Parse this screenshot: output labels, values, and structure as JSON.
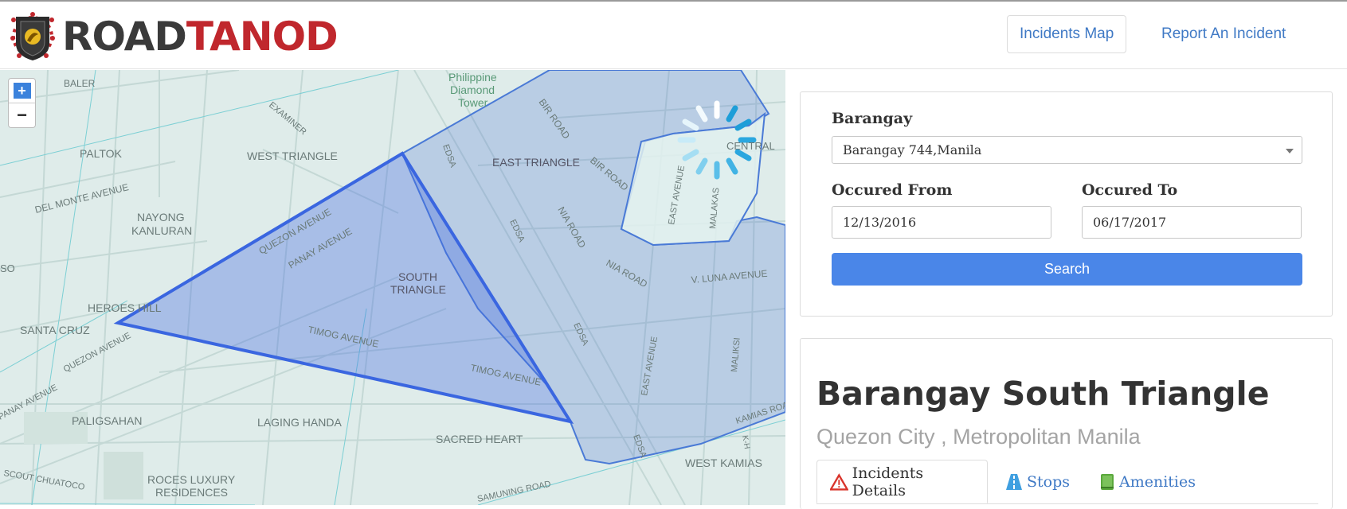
{
  "brand": {
    "part1": "ROAD",
    "part2": "TANOD",
    "logo_icon": "badge-logo-icon"
  },
  "nav": {
    "incidents_map": "Incidents Map",
    "report": "Report An Incident"
  },
  "map": {
    "zoom_in": "+",
    "zoom_out": "−",
    "labels": {
      "baler": "BALER",
      "philippine": "Philippine",
      "diamond": "Diamond",
      "tower": "Tower",
      "examiner": "EXAMINER",
      "paltok": "PALTOK",
      "west_triangle": "WEST TRIANGLE",
      "east_triangle": "EAST TRIANGLE",
      "bir_road": "BIR ROAD",
      "central": "CENTRAL",
      "del_monte": "DEL MONTE AVENUE",
      "nayong": "NAYONG",
      "kanluran": "KANLURAN",
      "quezon_ave": "QUEZON AVENUE",
      "panay_ave": "PANAY AVENUE",
      "south": "SOUTH",
      "triangle": "TRIANGLE",
      "edsa": "EDSA",
      "nia_road": "NIA ROAD",
      "east_avenue": "EAST AVENUE",
      "malakas": "MALAKAS",
      "so": "SO",
      "heroes_hill": "HEROES HILL",
      "santa_cruz": "SANTA CRUZ",
      "timog_ave": "TIMOG AVENUE",
      "v_luna": "V. LUNA AVENUE",
      "maliksi": "MALIKSI",
      "kamias_road": "KAMIAS ROAD",
      "paligsahan": "PALIGSAHAN",
      "laging_handa": "LAGING HANDA",
      "sacred_heart": "SACRED HEART",
      "west_kamias": "WEST KAMIAS",
      "scout_chuatoco": "SCOUT CHUATOCO",
      "roces": "ROCES LUXURY",
      "residences": "RESIDENCES",
      "samuning": "SAMUNING ROAD",
      "k_h": "K-H"
    }
  },
  "filters": {
    "barangay_label": "Barangay",
    "barangay_value": "Barangay 744,Manila",
    "from_label": "Occured From",
    "from_value": "12/13/2016",
    "to_label": "Occured To",
    "to_value": "06/17/2017",
    "search_label": "Search"
  },
  "details": {
    "title": "Barangay South Triangle",
    "subtitle": "Quezon City , Metropolitan Manila",
    "tabs": [
      {
        "label": "Incidents Details",
        "icon": "warning-icon"
      },
      {
        "label": "Stops",
        "icon": "road-icon"
      },
      {
        "label": "Amenities",
        "icon": "book-icon"
      }
    ]
  },
  "colors": {
    "accent": "#4a86e8",
    "link": "#3f79c5",
    "brand_red": "#c0272d",
    "polygon": "#4169e1"
  }
}
